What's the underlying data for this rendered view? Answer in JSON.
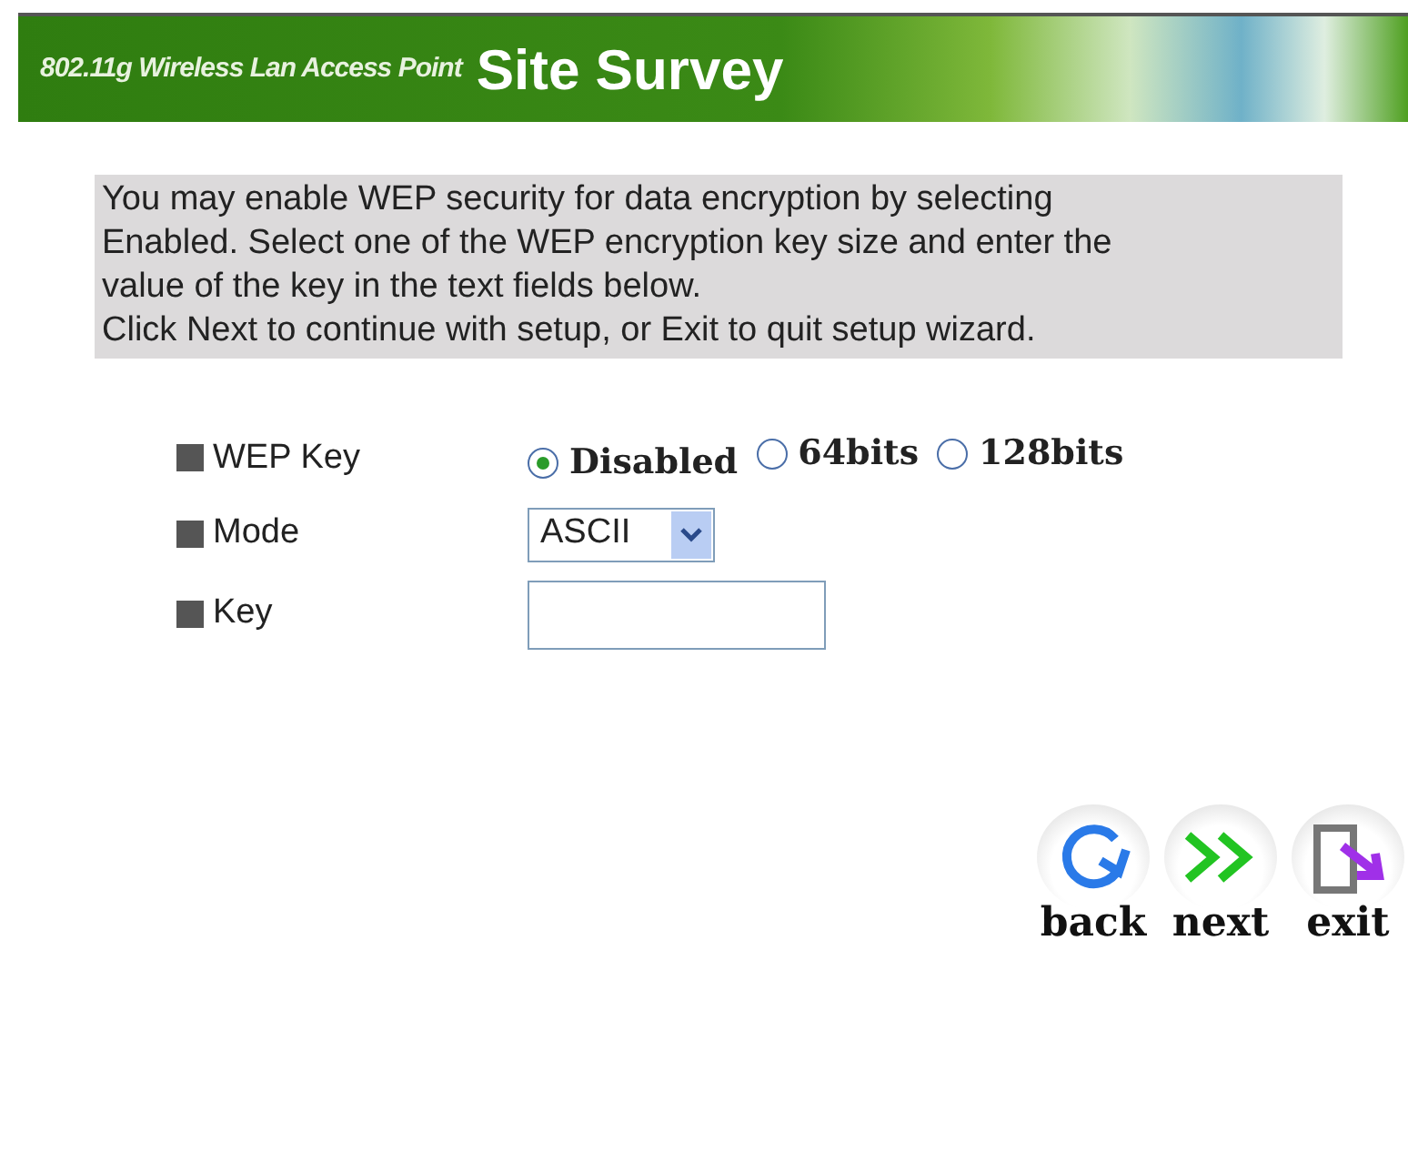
{
  "banner": {
    "subtitle": "802.11g Wireless Lan Access Point",
    "title": "Site Survey"
  },
  "intro": [
    "You may enable WEP security for data encryption by selecting",
    "Enabled. Select one of the WEP encryption key size and enter the",
    "value of the key in the text fields below.",
    "Click Next to continue with setup, or Exit to quit setup wizard."
  ],
  "fields": [
    {
      "kind": "radio",
      "label": "WEP Key",
      "options": [
        {
          "label": "Disabled",
          "selected": true
        },
        {
          "label": "64bits",
          "selected": false
        },
        {
          "label": "128bits",
          "selected": false
        }
      ]
    },
    {
      "kind": "select",
      "label": "Mode",
      "value": "ASCII"
    },
    {
      "kind": "text",
      "label": "Key"
    }
  ],
  "buttons": [
    {
      "kind": "back",
      "label": "back"
    },
    {
      "kind": "next",
      "label": "next"
    },
    {
      "kind": "exit",
      "label": "exit"
    }
  ]
}
